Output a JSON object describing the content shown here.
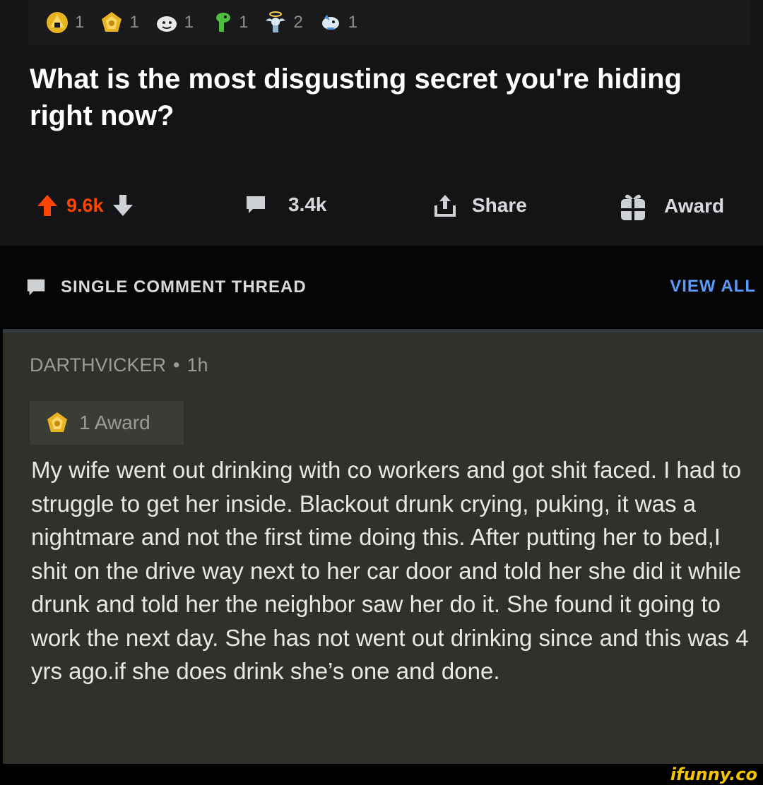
{
  "post": {
    "awards": [
      {
        "icon": "gold-pyramid-award-icon",
        "count": "1"
      },
      {
        "icon": "gold-badge-award-icon",
        "count": "1"
      },
      {
        "icon": "face-award-icon",
        "count": "1"
      },
      {
        "icon": "green-dino-award-icon",
        "count": "1"
      },
      {
        "icon": "angel-award-icon",
        "count": "2"
      },
      {
        "icon": "bird-award-icon",
        "count": "1"
      }
    ],
    "title": "What is the most disgusting secret you're hiding right now?",
    "upvotes": "9.6k",
    "comments": "3.4k",
    "share_label": "Share",
    "award_label": "Award",
    "colors": {
      "upvote": "#ff4500",
      "link": "#5a9bff",
      "comment_bg": "#2f322a"
    }
  },
  "thread": {
    "label": "SINGLE COMMENT THREAD",
    "view_all": "VIEW ALL"
  },
  "comment": {
    "author": "DARTHVICKER",
    "separator": "•",
    "time": "1h",
    "award_text": "1 Award",
    "body": "My wife went out drinking with co workers and got shit faced. I had to struggle to get her inside. Blackout drunk crying, puking, it was a nightmare and not the first time doing this. After putting her to bed,I shit on the drive way next to her car door and told her she did it while drunk and told her the neighbor saw her do it. She found it going to work the next day. She has not went out drinking since and this was 4 yrs ago.if she does drink she’s one and done."
  },
  "watermark": "ifunny.co"
}
